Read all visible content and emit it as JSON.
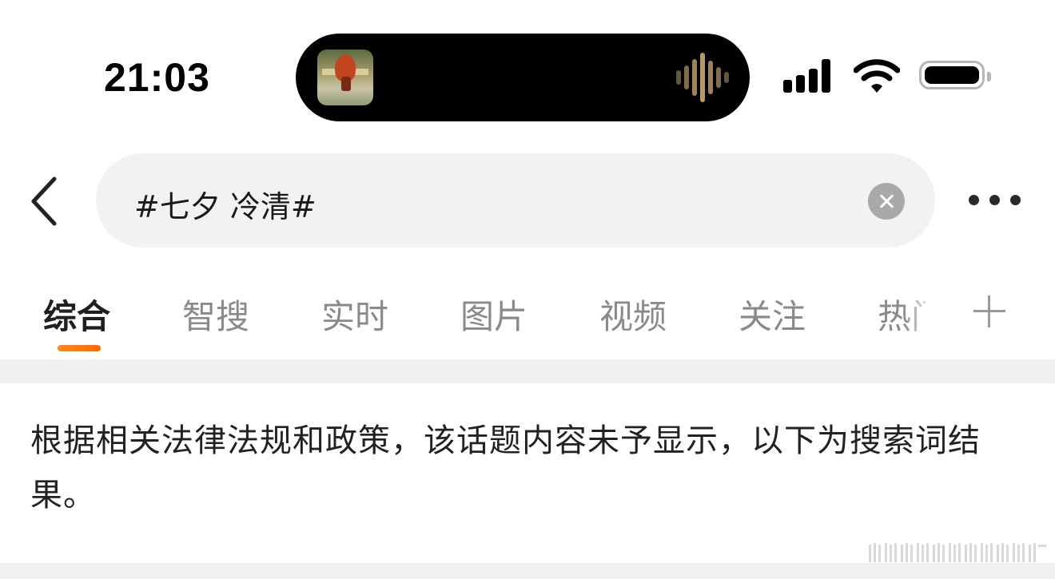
{
  "status_bar": {
    "time": "21:03"
  },
  "search": {
    "query": "#七夕 冷清#"
  },
  "tabs": [
    {
      "label": "综合",
      "active": true
    },
    {
      "label": "智搜",
      "active": false
    },
    {
      "label": "实时",
      "active": false
    },
    {
      "label": "图片",
      "active": false
    },
    {
      "label": "视频",
      "active": false
    },
    {
      "label": "关注",
      "active": false
    },
    {
      "label": "热门",
      "active": false
    }
  ],
  "notice": {
    "text": "根据相关法律法规和政策，该话题内容未予显示，以下为搜索词结果。"
  },
  "icons": {
    "back": "chevron-left-icon",
    "clear": "clear-circle-icon",
    "more": "more-horizontal-icon",
    "add_tab": "plus-icon",
    "signal": "cellular-signal-icon",
    "wifi": "wifi-icon",
    "battery": "battery-icon"
  },
  "colors": {
    "accent": "#ff7a00",
    "tab_active": "#1f1f1f",
    "tab_inactive": "#8a8a8a",
    "search_bg": "#f2f2f2"
  }
}
